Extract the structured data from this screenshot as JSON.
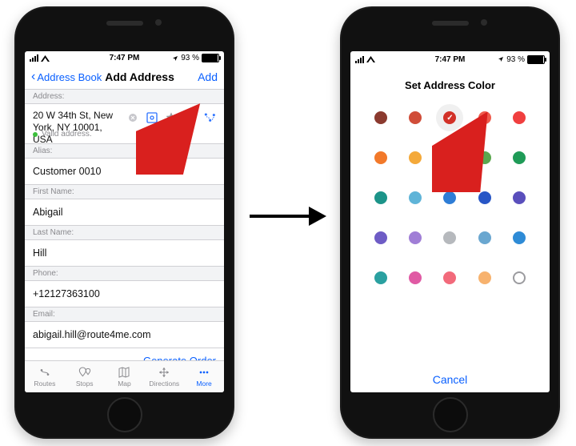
{
  "status": {
    "time": "7:47 PM",
    "battery": "93 %"
  },
  "left": {
    "nav": {
      "back": "Address Book",
      "title": "Add Address",
      "action": "Add"
    },
    "sections": {
      "address_label": "Address:",
      "address_value": "20 W 34th St, New York, NY 10001, USA",
      "valid_text": "Valid address.",
      "alias_label": "Alias:",
      "alias_value": "Customer 0010",
      "first_name_label": "First Name:",
      "first_name_value": "Abigail",
      "last_name_label": "Last Name:",
      "last_name_value": "Hill",
      "phone_label": "Phone:",
      "phone_value": "+12127363100",
      "email_label": "Email:",
      "email_value": "abigail.hill@route4me.com"
    },
    "footer_action": "Generate Order",
    "tabs": [
      {
        "label": "Routes"
      },
      {
        "label": "Stops"
      },
      {
        "label": "Map"
      },
      {
        "label": "Directions"
      },
      {
        "label": "More"
      }
    ]
  },
  "right": {
    "title": "Set Address Color",
    "cancel": "Cancel",
    "colors": [
      [
        "#8b3a2f",
        "#d04d39",
        "#e0352b",
        "#ef5b4c",
        "#f03f3f"
      ],
      [
        "#f2792a",
        "#f4a93a",
        "#f6d13e",
        "#5aa84f",
        "#1f9b57"
      ],
      [
        "#1c9489",
        "#5fb4d8",
        "#2e7dd6",
        "#2856c6",
        "#5a4fbc"
      ],
      [
        "#6e5cc5",
        "#a07ed6",
        "#b6b9bd",
        "#6aa7d0",
        "#2e8bd6"
      ],
      [
        "#2aa0a0",
        "#e05aa4",
        "#f26a7b",
        "#f7b26e",
        "#ffffff"
      ]
    ],
    "colors_ring": [
      [
        4,
        4
      ]
    ],
    "selected": [
      0,
      2
    ]
  }
}
